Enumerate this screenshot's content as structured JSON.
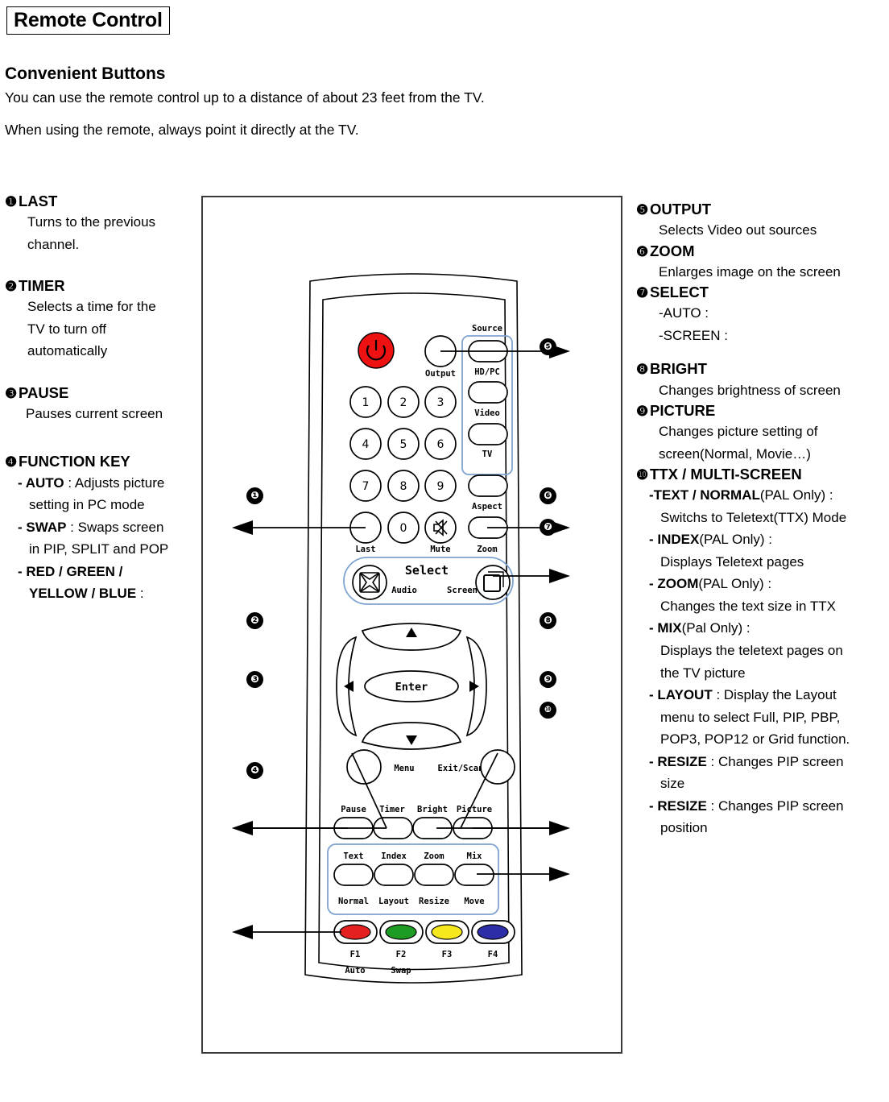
{
  "header": {
    "title": "Remote Control",
    "section": "Convenient Buttons",
    "intro_line1": "You can use the remote control up to a distance of about 23 feet from the TV.",
    "intro_line2": "When using the remote, always point it directly at the TV."
  },
  "left_column": [
    {
      "num": "❶",
      "title": "LAST",
      "lines": [
        "Turns to the previous",
        "channel."
      ]
    },
    {
      "num": "❷",
      "title": "TIMER",
      "lines": [
        "Selects a time for the",
        "TV to turn off",
        "automatically"
      ]
    },
    {
      "num": "❸",
      "title": "PAUSE",
      "lines": [
        "Pauses current screen"
      ]
    },
    {
      "num": "❹",
      "title": "FUNCTION KEY",
      "lines": []
    }
  ],
  "left_function_sub": [
    {
      "bold": "- AUTO",
      "rest": " : Adjusts picture",
      "cont": "setting in PC mode"
    },
    {
      "bold": "- SWAP",
      "rest": " : Swaps screen",
      "cont": "in PIP, SPLIT and POP"
    },
    {
      "bold": "- RED / GREEN /",
      "rest": "",
      "cont_bold": "YELLOW / BLUE",
      "cont_rest": " :"
    }
  ],
  "right_column": [
    {
      "num": "❺",
      "title": "OUTPUT",
      "lines": [
        "Selects Video out sources"
      ]
    },
    {
      "num": "❻",
      "title": "ZOOM",
      "lines": [
        "Enlarges image on the screen"
      ]
    },
    {
      "num": "❼",
      "title": "SELECT",
      "lines": [
        "-AUTO :",
        "-SCREEN :"
      ]
    },
    {
      "num": "❽",
      "title": "BRIGHT",
      "lines": [
        "Changes brightness of screen"
      ]
    },
    {
      "num": "❾",
      "title": "PICTURE",
      "lines": [
        "Changes picture setting of",
        "screen(Normal, Movie…)"
      ]
    },
    {
      "num": "❿",
      "title": "TTX / MULTI-SCREEN",
      "lines": []
    }
  ],
  "right_ttx_sub": [
    {
      "bold": "-TEXT / NORMAL",
      "plain": "(PAL Only) :",
      "cont": [
        "Switchs to Teletext(TTX) Mode"
      ]
    },
    {
      "bold": "- INDEX",
      "plain": "(PAL Only) :",
      "cont": [
        "Displays Teletext pages"
      ]
    },
    {
      "bold": "- ZOOM",
      "plain": "(PAL Only) :",
      "cont": [
        "Changes the text size in TTX"
      ]
    },
    {
      "bold": "- MIX",
      "plain": "(Pal Only) :",
      "cont": [
        "Displays the teletext pages on",
        "the TV picture"
      ]
    },
    {
      "bold": "- LAYOUT",
      "plain": " : Display the Layout",
      "cont": [
        "menu to select Full, PIP, PBP,",
        "POP3, POP12 or Grid function."
      ]
    },
    {
      "bold": "- RESIZE",
      "plain": " : Changes PIP screen",
      "cont": [
        "size"
      ]
    },
    {
      "bold": "- RESIZE",
      "plain": " : Changes PIP screen",
      "cont": [
        "position"
      ]
    }
  ],
  "callouts": {
    "left": [
      "❶",
      "❷",
      "❸",
      "❹"
    ],
    "right": [
      "❺",
      "❻",
      "❼",
      "❽",
      "❾",
      "❿"
    ]
  },
  "remote": {
    "power_color": "#ee1111",
    "accent_outline": "#7fa3cf",
    "labels": {
      "source": "Source",
      "output": "Output",
      "hdpc": "HD/PC",
      "video": "Video",
      "tv": "TV",
      "aspect": "Aspect",
      "last": "Last",
      "mute": "Mute",
      "zoom": "Zoom",
      "select": "Select",
      "audio": "Audio",
      "screen": "Screen",
      "enter": "Enter",
      "menu": "Menu",
      "exitscan": "Exit/Scan",
      "pause": "Pause",
      "timer": "Timer",
      "bright": "Bright",
      "picture": "Picture",
      "text": "Text",
      "index": "Index",
      "ttxzoom": "Zoom",
      "mix": "Mix",
      "normal": "Normal",
      "layout": "Layout",
      "resize": "Resize",
      "move": "Move",
      "f1": "F1",
      "f2": "F2",
      "f3": "F3",
      "f4": "F4",
      "auto": "Auto",
      "swap": "Swap"
    },
    "keypad": [
      "1",
      "2",
      "3",
      "4",
      "5",
      "6",
      "7",
      "8",
      "9",
      "0"
    ],
    "fkey_colors": [
      "#e52020",
      "#1d9b22",
      "#f6e81c",
      "#2d2da8"
    ]
  }
}
